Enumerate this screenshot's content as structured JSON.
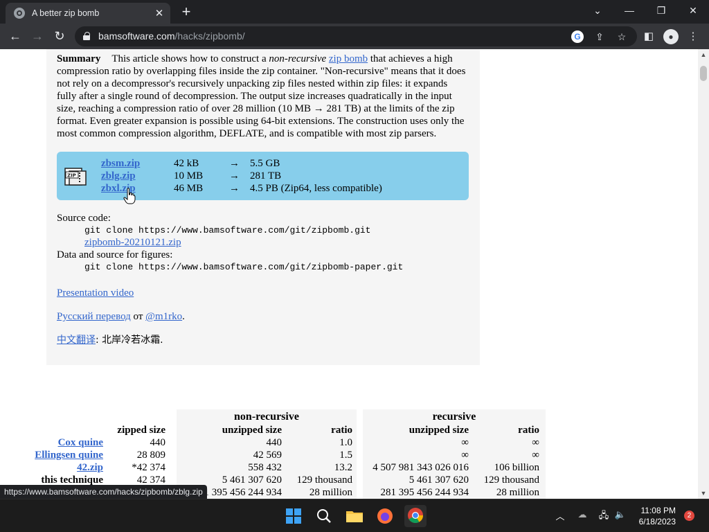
{
  "browser": {
    "tab_title": "A better zip bomb",
    "tab_close": "✕",
    "new_tab": "+",
    "url_domain": "bamsoftware.com",
    "url_path": "/hacks/zipbomb/",
    "status_url": "https://www.bamsoftware.com/hacks/zipbomb/zblg.zip"
  },
  "article": {
    "summary_label": "Summary",
    "summary_1": "This article shows how to construct a ",
    "summary_em": "non-recursive",
    "summary_2": " ",
    "summary_link": "zip bomb",
    "summary_3": " that achieves a high compression ratio by overlapping files inside the zip container. \"Non-recursive\" means that it does not rely on a decompressor's recursively unpacking zip files nested within zip files: it expands fully after a single round of decompression. The output size increases quadratically in the input size, reaching a compression ratio of over 28 million (10 MB → 281 TB) at the limits of the zip format. Even greater expansion is possible using 64-bit extensions. The construction uses only the most common compression algorithm, DEFLATE, and is compatible with most zip parsers.",
    "downloads": [
      {
        "file": "zbsm.zip",
        "size": "42 kB",
        "arrow": "→",
        "expanded": "5.5 GB"
      },
      {
        "file": "zblg.zip",
        "size": "10 MB",
        "arrow": "→",
        "expanded": "281 TB"
      },
      {
        "file": "zbxl.zip",
        "size": "46 MB",
        "arrow": "→",
        "expanded": "4.5 PB (Zip64, less compatible)"
      }
    ],
    "source_label": "Source code:",
    "source_cmd": "git clone https://www.bamsoftware.com/git/zipbomb.git",
    "source_zip": "zipbomb-20210121.zip",
    "data_label": "Data and source for figures:",
    "data_cmd": "git clone https://www.bamsoftware.com/git/zipbomb-paper.git",
    "video_link": "Presentation video",
    "ru_link": "Русский перевод",
    "ru_from": " от ",
    "ru_author": "@m1rko",
    "ru_end": ".",
    "zh_link": "中文翻译",
    "zh_rest": ": 北岸冷若冰霜."
  },
  "comparison": {
    "group_nonrec": "non-recursive",
    "group_rec": "recursive",
    "headers": [
      "zipped size",
      "unzipped size",
      "ratio",
      "unzipped size",
      "ratio"
    ],
    "rows": [
      {
        "name": "Cox quine",
        "link": true,
        "zipped": "440",
        "nr_unz": "440",
        "nr_ratio": "1.0",
        "r_unz": "∞",
        "r_ratio": "∞"
      },
      {
        "name": "Ellingsen quine",
        "link": true,
        "zipped": "28 809",
        "nr_unz": "42 569",
        "nr_ratio": "1.5",
        "r_unz": "∞",
        "r_ratio": "∞"
      },
      {
        "name": "42.zip",
        "link": true,
        "zipped": "*42 374",
        "nr_unz": "558 432",
        "nr_ratio": "13.2",
        "r_unz": "4 507 981 343 026 016",
        "r_ratio": "106 billion"
      },
      {
        "name": "this technique",
        "link": false,
        "zipped": "42 374",
        "nr_unz": "5 461 307 620",
        "nr_ratio": "129 thousand",
        "r_unz": "5 461 307 620",
        "r_ratio": "129 thousand"
      },
      {
        "name": "",
        "link": false,
        "zipped": "",
        "nr_unz": "281 395 456 244 934",
        "nr_ratio": "28 million",
        "r_unz": "281 395 456 244 934",
        "r_ratio": "28 million"
      }
    ]
  },
  "taskbar": {
    "time": "11:08 PM",
    "date": "6/18/2023",
    "badge": "2"
  }
}
